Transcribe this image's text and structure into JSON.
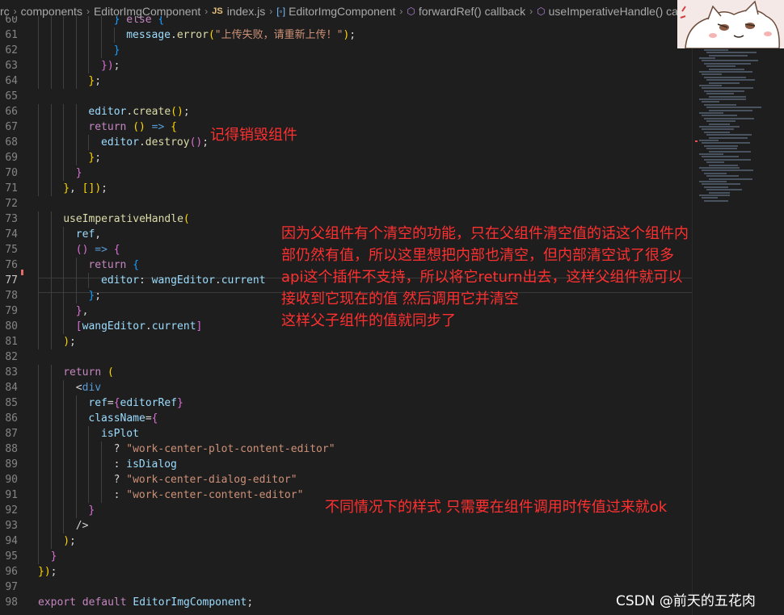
{
  "breadcrumb": [
    {
      "kind": "text",
      "label": "rc"
    },
    {
      "kind": "text",
      "label": "components"
    },
    {
      "kind": "text",
      "label": "EditorImgComponent"
    },
    {
      "kind": "js",
      "badge": "JS",
      "label": "index.js"
    },
    {
      "kind": "class",
      "label": "EditorImgComponent"
    },
    {
      "kind": "method",
      "label": "forwardRef() callback"
    },
    {
      "kind": "method",
      "label": "useImperativeHandle() callback"
    }
  ],
  "code": {
    "active_line": 77,
    "lines": [
      {
        "n": 60,
        "i": 6,
        "t": [
          [
            "} ",
            "p3"
          ],
          [
            "else ",
            "ctl"
          ],
          [
            "{",
            "p3"
          ]
        ]
      },
      {
        "n": 61,
        "i": 7,
        "t": [
          [
            "message",
            "var"
          ],
          [
            ".",
            "pun"
          ],
          [
            "error",
            "fn"
          ],
          [
            "(",
            "p1"
          ],
          [
            "\"上传失败，请重新上传！\"",
            "str"
          ],
          [
            ")",
            "p1"
          ],
          [
            ";",
            "pun"
          ]
        ]
      },
      {
        "n": 62,
        "i": 6,
        "t": [
          [
            "}",
            "p3"
          ]
        ]
      },
      {
        "n": 63,
        "i": 5,
        "t": [
          [
            "}",
            "p2"
          ],
          [
            ")",
            "p2"
          ],
          [
            ";",
            "pun"
          ]
        ]
      },
      {
        "n": 64,
        "i": 4,
        "t": [
          [
            "}",
            "p1"
          ],
          [
            ";",
            "pun"
          ]
        ]
      },
      {
        "n": 65,
        "i": 0,
        "t": []
      },
      {
        "n": 66,
        "i": 4,
        "t": [
          [
            "editor",
            "var"
          ],
          [
            ".",
            "pun"
          ],
          [
            "create",
            "fn"
          ],
          [
            "()",
            "p1"
          ],
          [
            ";",
            "pun"
          ]
        ]
      },
      {
        "n": 67,
        "i": 4,
        "t": [
          [
            "return ",
            "ctl"
          ],
          [
            "() ",
            "p1"
          ],
          [
            "=> ",
            "kw"
          ],
          [
            "{",
            "p1"
          ]
        ]
      },
      {
        "n": 68,
        "i": 5,
        "t": [
          [
            "editor",
            "var"
          ],
          [
            ".",
            "pun"
          ],
          [
            "destroy",
            "fn"
          ],
          [
            "()",
            "p2"
          ],
          [
            ";",
            "pun"
          ]
        ]
      },
      {
        "n": 69,
        "i": 4,
        "t": [
          [
            "}",
            "p1"
          ],
          [
            ";",
            "pun"
          ]
        ]
      },
      {
        "n": 70,
        "i": 3,
        "t": [
          [
            "}",
            "p2"
          ]
        ]
      },
      {
        "n": 71,
        "i": 2,
        "t": [
          [
            "}",
            "p1"
          ],
          [
            ", ",
            "pun"
          ],
          [
            "[]",
            "p1"
          ],
          [
            ")",
            "p1"
          ],
          [
            ";",
            "pun"
          ]
        ]
      },
      {
        "n": 72,
        "i": 0,
        "t": []
      },
      {
        "n": 73,
        "i": 2,
        "t": [
          [
            "useImperativeHandle",
            "fn"
          ],
          [
            "(",
            "p1"
          ]
        ]
      },
      {
        "n": 74,
        "i": 3,
        "t": [
          [
            "ref",
            "var"
          ],
          [
            ",",
            "pun"
          ]
        ]
      },
      {
        "n": 75,
        "i": 3,
        "t": [
          [
            "() ",
            "p2"
          ],
          [
            "=> ",
            "kw"
          ],
          [
            "{",
            "p2"
          ]
        ]
      },
      {
        "n": 76,
        "i": 4,
        "t": [
          [
            "return ",
            "ctl"
          ],
          [
            "{",
            "p3"
          ]
        ]
      },
      {
        "n": 77,
        "i": 5,
        "t": [
          [
            "editor",
            "var"
          ],
          [
            ": ",
            "pun"
          ],
          [
            "wangEditor",
            "var"
          ],
          [
            ".",
            "pun"
          ],
          [
            "current",
            "var"
          ]
        ]
      },
      {
        "n": 78,
        "i": 4,
        "t": [
          [
            "}",
            "p3"
          ],
          [
            ";",
            "pun"
          ]
        ]
      },
      {
        "n": 79,
        "i": 3,
        "t": [
          [
            "}",
            "p2"
          ],
          [
            ",",
            "pun"
          ]
        ]
      },
      {
        "n": 80,
        "i": 3,
        "t": [
          [
            "[",
            "p2"
          ],
          [
            "wangEditor",
            "var"
          ],
          [
            ".",
            "pun"
          ],
          [
            "current",
            "var"
          ],
          [
            "]",
            "p2"
          ]
        ]
      },
      {
        "n": 81,
        "i": 2,
        "t": [
          [
            ")",
            "p1"
          ],
          [
            ";",
            "pun"
          ]
        ]
      },
      {
        "n": 82,
        "i": 0,
        "t": []
      },
      {
        "n": 83,
        "i": 2,
        "t": [
          [
            "return ",
            "ctl"
          ],
          [
            "(",
            "p1"
          ]
        ]
      },
      {
        "n": 84,
        "i": 3,
        "t": [
          [
            "<",
            "pun"
          ],
          [
            "div",
            "tag"
          ]
        ]
      },
      {
        "n": 85,
        "i": 4,
        "t": [
          [
            "ref",
            "attr"
          ],
          [
            "=",
            "pun"
          ],
          [
            "{",
            "p2"
          ],
          [
            "editorRef",
            "var"
          ],
          [
            "}",
            "p2"
          ]
        ]
      },
      {
        "n": 86,
        "i": 4,
        "t": [
          [
            "className",
            "attr"
          ],
          [
            "=",
            "pun"
          ],
          [
            "{",
            "p2"
          ]
        ]
      },
      {
        "n": 87,
        "i": 5,
        "t": [
          [
            "isPlot",
            "var"
          ]
        ]
      },
      {
        "n": 88,
        "i": 6,
        "t": [
          [
            "? ",
            "pun"
          ],
          [
            "\"work-center-plot-content-editor\"",
            "str"
          ]
        ]
      },
      {
        "n": 89,
        "i": 6,
        "t": [
          [
            ": ",
            "pun"
          ],
          [
            "isDialog",
            "var"
          ]
        ]
      },
      {
        "n": 90,
        "i": 6,
        "t": [
          [
            "? ",
            "pun"
          ],
          [
            "\"work-center-dialog-editor\"",
            "str"
          ]
        ]
      },
      {
        "n": 91,
        "i": 6,
        "t": [
          [
            ": ",
            "pun"
          ],
          [
            "\"work-center-content-editor\"",
            "str"
          ]
        ]
      },
      {
        "n": 92,
        "i": 4,
        "t": [
          [
            "}",
            "p2"
          ]
        ]
      },
      {
        "n": 93,
        "i": 3,
        "t": [
          [
            "/>",
            "pun"
          ]
        ]
      },
      {
        "n": 94,
        "i": 2,
        "t": [
          [
            ")",
            "p1"
          ],
          [
            ";",
            "pun"
          ]
        ]
      },
      {
        "n": 95,
        "i": 1,
        "t": [
          [
            "}",
            "p2"
          ]
        ]
      },
      {
        "n": 96,
        "i": 0,
        "t": [
          [
            "}",
            "p1"
          ],
          [
            ")",
            "p1"
          ],
          [
            ";",
            "pun"
          ]
        ]
      },
      {
        "n": 97,
        "i": 0,
        "t": []
      },
      {
        "n": 98,
        "i": 0,
        "t": [
          [
            "export ",
            "ctl"
          ],
          [
            "default ",
            "ctl"
          ],
          [
            "EditorImgComponent",
            "var"
          ],
          [
            ";",
            "pun"
          ]
        ]
      }
    ]
  },
  "annotations": {
    "destroy_note": "记得销毁组件",
    "clear_note": "因为父组件有个清空的功能，只在父组件清空值的话这个组件内\n部仍然有值，所以这里想把内部也清空，但内部清空试了很多\napi这个插件不支持，所以将它return出去，这样父组件就可以\n接收到它现在的值 然后调用它并清空\n这样父子组件的值就同步了",
    "style_note": "不同情况下的样式 只需要在组件调用时传值过来就ok"
  },
  "watermark": "CSDN @前天的五花肉",
  "colors": {
    "background": "#1e1e1e",
    "annotation": "#ff3030",
    "keyword": "#569cd6",
    "control": "#c586c0",
    "function": "#dcdcaa",
    "variable": "#9cdcfe",
    "string": "#ce9178"
  }
}
